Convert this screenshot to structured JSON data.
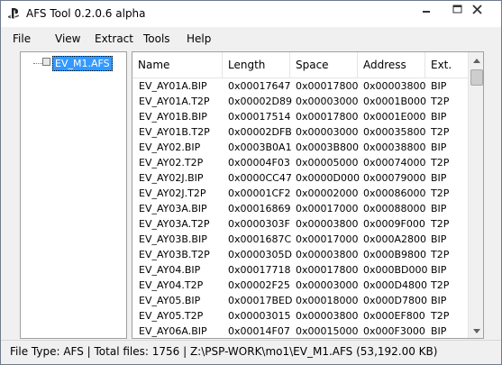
{
  "window": {
    "title": "AFS Tool 0.2.0.6 alpha"
  },
  "menu": [
    "File",
    "View",
    "Extract",
    "Tools",
    "Help"
  ],
  "tree": {
    "root": "EV_M1.AFS"
  },
  "table": {
    "columns": [
      "Name",
      "Length",
      "Space",
      "Address",
      "Ext."
    ],
    "rows": [
      [
        "EV_AY01A.BIP",
        "0x00017647",
        "0x00017800",
        "0x00003800",
        "BIP"
      ],
      [
        "EV_AY01A.T2P",
        "0x00002D89",
        "0x00003000",
        "0x0001B000",
        "T2P"
      ],
      [
        "EV_AY01B.BIP",
        "0x00017514",
        "0x00017800",
        "0x0001E000",
        "BIP"
      ],
      [
        "EV_AY01B.T2P",
        "0x00002DFB",
        "0x00003000",
        "0x00035800",
        "T2P"
      ],
      [
        "EV_AY02.BIP",
        "0x0003B0A1",
        "0x0003B800",
        "0x00038800",
        "BIP"
      ],
      [
        "EV_AY02.T2P",
        "0x00004F03",
        "0x00005000",
        "0x00074000",
        "T2P"
      ],
      [
        "EV_AY02J.BIP",
        "0x0000CC47",
        "0x0000D000",
        "0x00079000",
        "BIP"
      ],
      [
        "EV_AY02J.T2P",
        "0x00001CF2",
        "0x00002000",
        "0x00086000",
        "T2P"
      ],
      [
        "EV_AY03A.BIP",
        "0x00016869",
        "0x00017000",
        "0x00088000",
        "BIP"
      ],
      [
        "EV_AY03A.T2P",
        "0x0000303F",
        "0x00003800",
        "0x0009F000",
        "T2P"
      ],
      [
        "EV_AY03B.BIP",
        "0x0001687C",
        "0x00017000",
        "0x000A2800",
        "BIP"
      ],
      [
        "EV_AY03B.T2P",
        "0x0000305D",
        "0x00003800",
        "0x000B9800",
        "T2P"
      ],
      [
        "EV_AY04.BIP",
        "0x00017718",
        "0x00017800",
        "0x000BD000",
        "BIP"
      ],
      [
        "EV_AY04.T2P",
        "0x00002F25",
        "0x00003000",
        "0x000D4800",
        "T2P"
      ],
      [
        "EV_AY05.BIP",
        "0x00017BED",
        "0x00018000",
        "0x000D7800",
        "BIP"
      ],
      [
        "EV_AY05.T2P",
        "0x00003015",
        "0x00003800",
        "0x000EF800",
        "T2P"
      ],
      [
        "EV_AY06A.BIP",
        "0x00014F07",
        "0x00015000",
        "0x000F3000",
        "BIP"
      ]
    ]
  },
  "status": {
    "text": "File Type: AFS | Total files: 1756 | Z:\\PSP-WORK\\mo1\\EV_M1.AFS (53,192.00 KB)"
  },
  "icons": {
    "app": "playstation-icon",
    "minimize": "minimize-icon",
    "maximize": "maximize-icon",
    "close": "close-icon",
    "tree_node": "square-node-icon",
    "scroll_up": "chevron-up-icon",
    "scroll_down": "chevron-down-icon"
  }
}
